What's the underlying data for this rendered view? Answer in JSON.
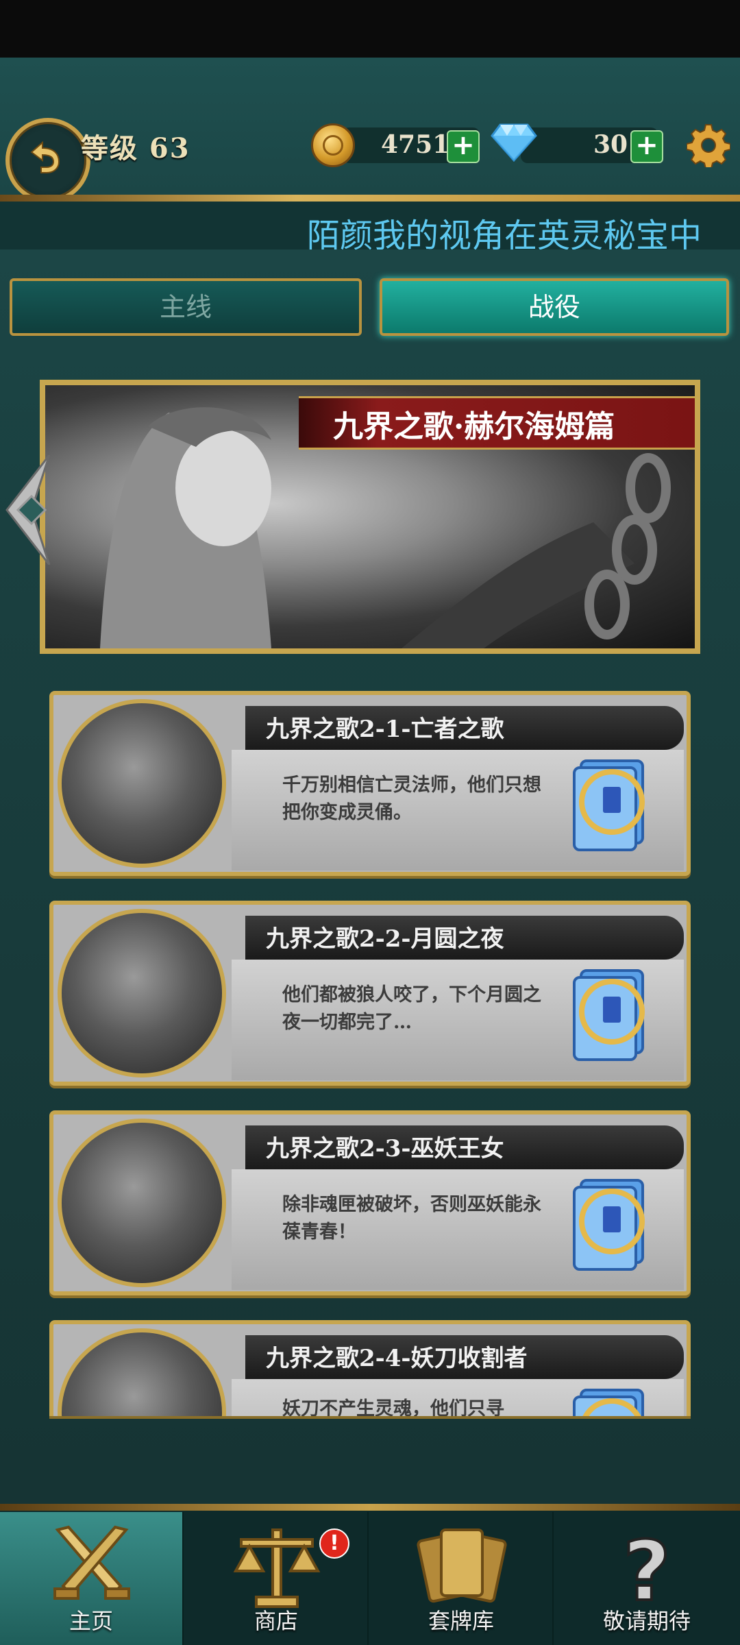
{
  "header": {
    "level_label": "等级 63",
    "coins": "4751",
    "gems": "30",
    "plus_symbol": "+",
    "marquee_text": "陌颜我的视角在英灵秘宝中"
  },
  "tabs": [
    {
      "label": "主线",
      "active": false
    },
    {
      "label": "战役",
      "active": true
    }
  ],
  "banner": {
    "title": "九界之歌·赫尔海姆篇"
  },
  "chapters": [
    {
      "title": "九界之歌2-1-亡者之歌",
      "desc": "千万别相信亡灵法师，他们只想把你变成灵俑。"
    },
    {
      "title": "九界之歌2-2-月圆之夜",
      "desc": "他们都被狼人咬了，下个月圆之夜一切都完了…"
    },
    {
      "title": "九界之歌2-3-巫妖王女",
      "desc": "除非魂匣被破坏，否则巫妖能永葆青春！"
    },
    {
      "title": "九界之歌2-4-妖刀收割者",
      "desc": "妖刀不产生灵魂，他们只寻"
    }
  ],
  "bottom_nav": [
    {
      "label": "主页",
      "icon": "crossed-swords-icon",
      "active": true
    },
    {
      "label": "商店",
      "icon": "scales-icon",
      "active": false,
      "badge": "!"
    },
    {
      "label": "套牌库",
      "icon": "cards-icon",
      "active": false
    },
    {
      "label": "敬请期待",
      "icon": "question-icon",
      "active": false
    }
  ],
  "colors": {
    "accent_gold": "#c7a64f",
    "teal_active": "#1aa392",
    "marquee_blue": "#5ec8f0",
    "badge_red": "#e0261c"
  }
}
